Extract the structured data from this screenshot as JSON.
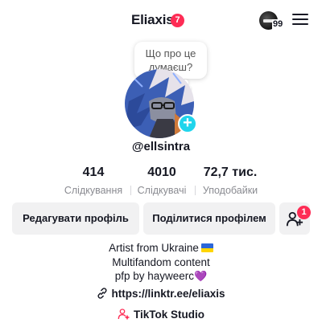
{
  "header": {
    "username": "Eliaxis",
    "notification_count": "7",
    "mini_avatar_count": "99",
    "menu_icon": "hamburger-menu-icon"
  },
  "profile": {
    "thought_bubble": "Що про це думаєш?",
    "handle": "@ellsintra",
    "add_icon": "plus-icon"
  },
  "stats": [
    {
      "value": "414",
      "label": "Слідкування"
    },
    {
      "value": "4010",
      "label": "Слідкувачі"
    },
    {
      "value": "72,7 тис.",
      "label": "Уподобайки"
    }
  ],
  "actions": {
    "edit_label": "Редагувати профіль",
    "share_label": "Поділитися профілем",
    "add_friends_icon": "add-person-icon",
    "add_friends_count": "1"
  },
  "bio": {
    "line1": "Artist from Ukraine",
    "line2": "Multifandom content",
    "line3": "pfp by hayweerc",
    "heart": "💜"
  },
  "link": {
    "icon": "link-icon",
    "text": "https://linktr.ee/eliaxis"
  },
  "studio": {
    "icon": "studio-icon",
    "text": "TikTok Studio"
  },
  "colors": {
    "accent_red": "#fe2c55",
    "add_badge_cyan": "#20d5ec",
    "button_bg": "#f1f1f2",
    "secondary_text": "#8a8b91"
  }
}
